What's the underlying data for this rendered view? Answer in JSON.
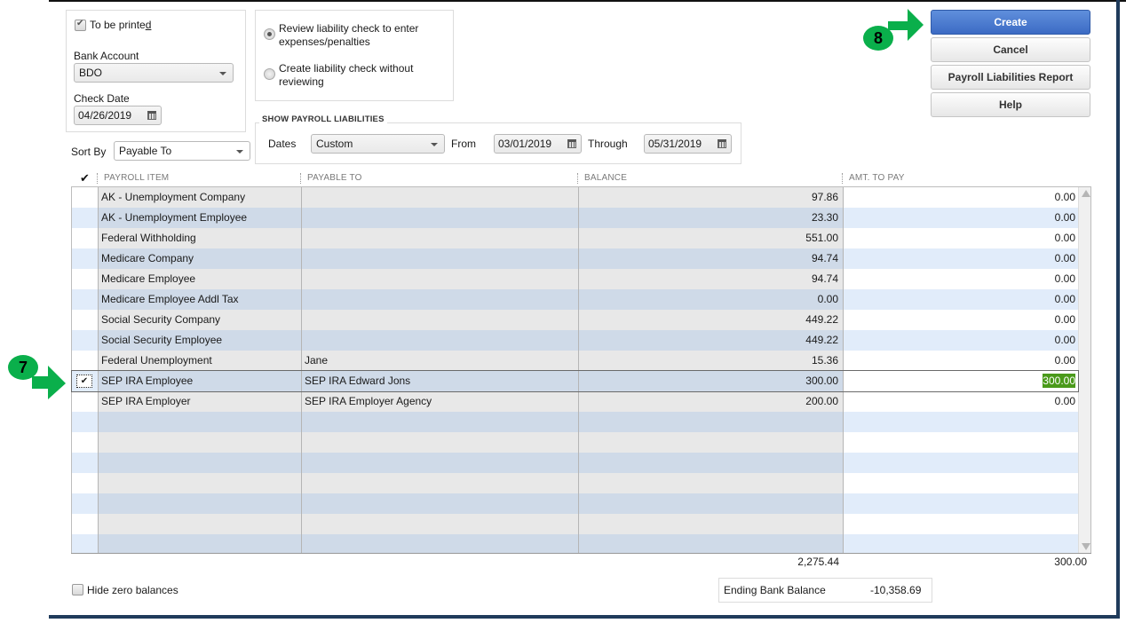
{
  "options": {
    "to_be_printed": {
      "label_prefix": "To be printe",
      "label_underlined": "d",
      "checked": true
    },
    "bank_account": {
      "label": "Bank Account",
      "value": "BDO"
    },
    "check_date": {
      "label": "Check Date",
      "value": "04/26/2019"
    },
    "sort_by": {
      "label": "Sort By",
      "value": "Payable To"
    }
  },
  "radio_group": {
    "review": {
      "line1": "Review liability check to enter",
      "line2": "expenses/penalties",
      "selected": true
    },
    "create": {
      "line1": "Create liability check without",
      "line2": "reviewing",
      "selected": false
    }
  },
  "show_liabilities": {
    "legend": "SHOW PAYROLL LIABILITIES",
    "dates_label": "Dates",
    "dates_value": "Custom",
    "from_label": "From",
    "from_value": "03/01/2019",
    "through_label": "Through",
    "through_value": "05/31/2019"
  },
  "buttons": {
    "create": "Create",
    "cancel": "Cancel",
    "report": "Payroll Liabilities Report",
    "help": "Help"
  },
  "annotations": {
    "step7": "7",
    "step8": "8",
    "accent": "#0aaf4b"
  },
  "table": {
    "columns": {
      "check": "✔",
      "item": "PAYROLL ITEM",
      "payable": "PAYABLE TO",
      "balance": "BALANCE",
      "amount": "AMT. TO PAY"
    },
    "rows": [
      {
        "checked": false,
        "item": "AK - Unemployment Company",
        "payable": "",
        "balance": "97.86",
        "amount": "0.00"
      },
      {
        "checked": false,
        "item": "AK - Unemployment Employee",
        "payable": "",
        "balance": "23.30",
        "amount": "0.00"
      },
      {
        "checked": false,
        "item": "Federal Withholding",
        "payable": "",
        "balance": "551.00",
        "amount": "0.00"
      },
      {
        "checked": false,
        "item": "Medicare Company",
        "payable": "",
        "balance": "94.74",
        "amount": "0.00"
      },
      {
        "checked": false,
        "item": "Medicare Employee",
        "payable": "",
        "balance": "94.74",
        "amount": "0.00"
      },
      {
        "checked": false,
        "item": "Medicare Employee Addl Tax",
        "payable": "",
        "balance": "0.00",
        "amount": "0.00"
      },
      {
        "checked": false,
        "item": "Social Security Company",
        "payable": "",
        "balance": "449.22",
        "amount": "0.00"
      },
      {
        "checked": false,
        "item": "Social Security Employee",
        "payable": "",
        "balance": "449.22",
        "amount": "0.00"
      },
      {
        "checked": false,
        "item": "Federal Unemployment",
        "payable": "Jane",
        "balance": "15.36",
        "amount": "0.00"
      },
      {
        "checked": true,
        "item": "SEP IRA Employee",
        "payable": "SEP IRA Edward Jons",
        "balance": "300.00",
        "amount": "300.00"
      },
      {
        "checked": false,
        "item": "SEP IRA Employer",
        "payable": "SEP IRA Employer Agency",
        "balance": "200.00",
        "amount": "0.00"
      }
    ],
    "check_glyph": "✔",
    "total_balance": "2,275.44",
    "total_amount": "300.00"
  },
  "footer": {
    "hide_zero_label": "Hide zero balances",
    "hide_zero_checked": false,
    "ending_balance_label": "Ending Bank Balance",
    "ending_balance_value": "-10,358.69"
  }
}
